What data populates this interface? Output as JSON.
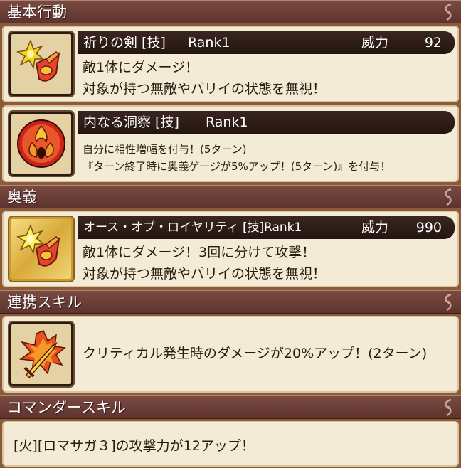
{
  "sections": {
    "basic": "基本行動",
    "ougi": "奥義",
    "renkei": "連携スキル",
    "commander": "コマンダースキル"
  },
  "skills": [
    {
      "name": "祈りの剣 [技]",
      "rank": "Rank1",
      "power_label": "威力",
      "power": "92",
      "icon": "burst-sword-shield-icon",
      "desc": [
        "敵1体にダメージ！",
        "対象が持つ無敵やパリイの状態を無視！"
      ]
    },
    {
      "name": "内なる洞察 [技]",
      "rank": "Rank1",
      "icon": "fire-drop-icon",
      "desc": [
        "自分に相性増幅を付与！(5ターン)",
        "『ターン終了時に奥義ゲージが5%アップ！(5ターン)』を付与！"
      ]
    },
    {
      "name": "オース・オブ・ロイヤリティ [技]",
      "rank": "Rank1",
      "power_label": "威力",
      "power": "990",
      "icon": "burst-sword-shield-icon",
      "desc": [
        "敵1体にダメージ！3回に分けて攻撃！",
        "対象が持つ無敵やパリイの状態を無視！"
      ]
    }
  ],
  "renkei": {
    "icon": "flaming-sword-icon",
    "desc": "クリティカル発生時のダメージが20%アップ！(2ターン)"
  },
  "commander": {
    "desc": "[火][ロマサガ３]の攻撃力が12アップ！"
  }
}
